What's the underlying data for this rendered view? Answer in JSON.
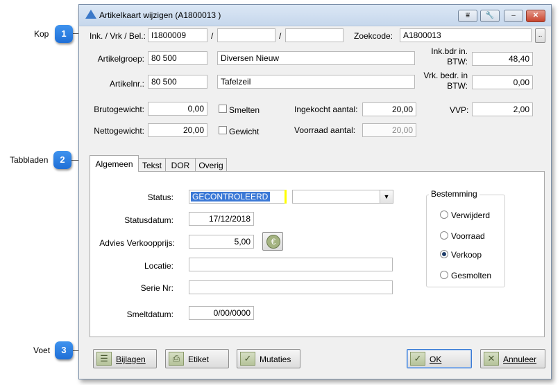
{
  "callouts": [
    {
      "label": "Kop",
      "number": "1"
    },
    {
      "label": "Tabbladen",
      "number": "2"
    },
    {
      "label": "Voet",
      "number": "3"
    }
  ],
  "window": {
    "title": "Artikelkaart wijzigen  (A1800013  )",
    "titlebar_buttons": [
      "⩸",
      "🔧",
      "–",
      "✕"
    ]
  },
  "header": {
    "ink_label": "Ink. / Vrk / Bel.:",
    "ink_value": "I1800009",
    "sep1": "/",
    "sep2": "/",
    "ink_value2": "",
    "ink_value3": "",
    "zoekcode_label": "Zoekcode:",
    "zoekcode_value": "A1800013",
    "zoekcode_button": "..",
    "artikelgroep_label": "Artikelgroep:",
    "artikelgroep_value": "80 500",
    "artikelgroep_desc": "Diversen Nieuw",
    "artikelnr_label": "Artikelnr.:",
    "artikelnr_value": "80 500",
    "artikelnr_desc": "Tafelzeil",
    "inkbdr_label_1": "Ink.bdr in.",
    "inkbdr_label_2": "BTW:",
    "inkbdr_value": "48,40",
    "vrkbedr_label_1": "Vrk. bedr. in",
    "vrkbedr_label_2": "BTW:",
    "vrkbedr_value": "0,00",
    "brutogewicht_label": "Brutogewicht:",
    "brutogewicht_value": "0,00",
    "nettogewicht_label": "Nettogewicht:",
    "nettogewicht_value": "20,00",
    "smelten_label": "Smelten",
    "gewicht_label": "Gewicht",
    "ingekocht_label": "Ingekocht aantal:",
    "ingekocht_value": "20,00",
    "voorraad_label": "Voorraad aantal:",
    "voorraad_value": "20,00",
    "vvp_label": "VVP:",
    "vvp_value": "2,00"
  },
  "tabs": [
    {
      "label": "Algemeen",
      "active": true
    },
    {
      "label": "Tekst",
      "active": false
    },
    {
      "label": "DOR",
      "active": false
    },
    {
      "label": "Overig",
      "active": false
    }
  ],
  "general": {
    "status_label": "Status:",
    "status_value": "GECONTROLEERD",
    "status_select_value": "",
    "statusdatum_label": "Statusdatum:",
    "statusdatum_value": "17/12/2018",
    "advies_label": "Advies Verkoopprijs:",
    "advies_value": "5,00",
    "locatie_label": "Locatie:",
    "locatie_value": "",
    "serie_label": "Serie Nr:",
    "serie_value": "",
    "smeltdatum_label": "Smeltdatum:",
    "smeltdatum_value": "0/00/0000",
    "bestemming_legend": "Bestemming",
    "bestemming_options": [
      "Verwijderd",
      "Voorraad",
      "Verkoop",
      "Gesmolten"
    ],
    "bestemming_selected": "Verkoop"
  },
  "footer": {
    "bijlagen": "Bijlagen",
    "etiket": "Etiket",
    "mutaties": "Mutaties",
    "ok": "OK",
    "annuleer": "Annuleer"
  },
  "colors": {
    "status_highlight": "#ffff00",
    "status_selected_text_bg": "#3a78d6",
    "badge": "#2a7fe0"
  }
}
